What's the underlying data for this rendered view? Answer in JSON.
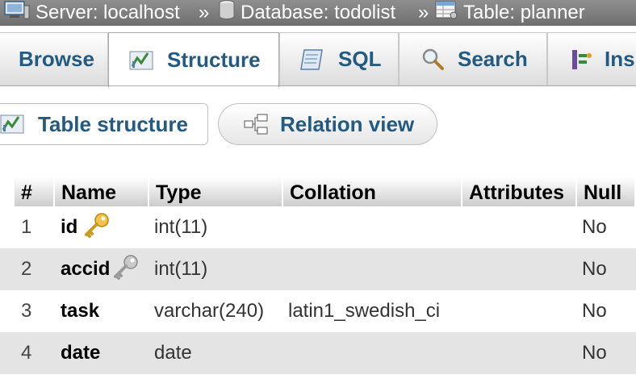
{
  "breadcrumb": {
    "server": "Server: localhost",
    "database": "Database: todolist",
    "table": "Table: planner",
    "separator": "»"
  },
  "tabs": [
    {
      "label": "Browse",
      "icon": "browse-icon"
    },
    {
      "label": "Structure",
      "icon": "structure-icon",
      "active": true
    },
    {
      "label": "SQL",
      "icon": "sql-icon"
    },
    {
      "label": "Search",
      "icon": "search-icon"
    },
    {
      "label": "Ins",
      "icon": "insert-icon"
    }
  ],
  "subtabs": [
    {
      "label": "Table structure",
      "icon": "structure-icon",
      "active": true
    },
    {
      "label": "Relation view",
      "icon": "relation-icon"
    }
  ],
  "table": {
    "headers": [
      "#",
      "Name",
      "Type",
      "Collation",
      "Attributes",
      "Null"
    ],
    "rows": [
      {
        "num": "1",
        "name": "id",
        "key": "primary-key-icon",
        "type": "int(11)",
        "collation": "",
        "attributes": "",
        "null": "No"
      },
      {
        "num": "2",
        "name": "accid",
        "key": "index-key-icon",
        "type": "int(11)",
        "collation": "",
        "attributes": "",
        "null": "No"
      },
      {
        "num": "3",
        "name": "task",
        "key": "",
        "type": "varchar(240)",
        "collation": "latin1_swedish_ci",
        "attributes": "",
        "null": "No"
      },
      {
        "num": "4",
        "name": "date",
        "key": "",
        "type": "date",
        "collation": "",
        "attributes": "",
        "null": "No"
      }
    ]
  },
  "colors": {
    "link": "#235a81",
    "header_bar": "#7f7f7f",
    "row_alt": "#e4e4e4",
    "primary_key": "#e0b040",
    "index_key": "#a0a0a0"
  }
}
